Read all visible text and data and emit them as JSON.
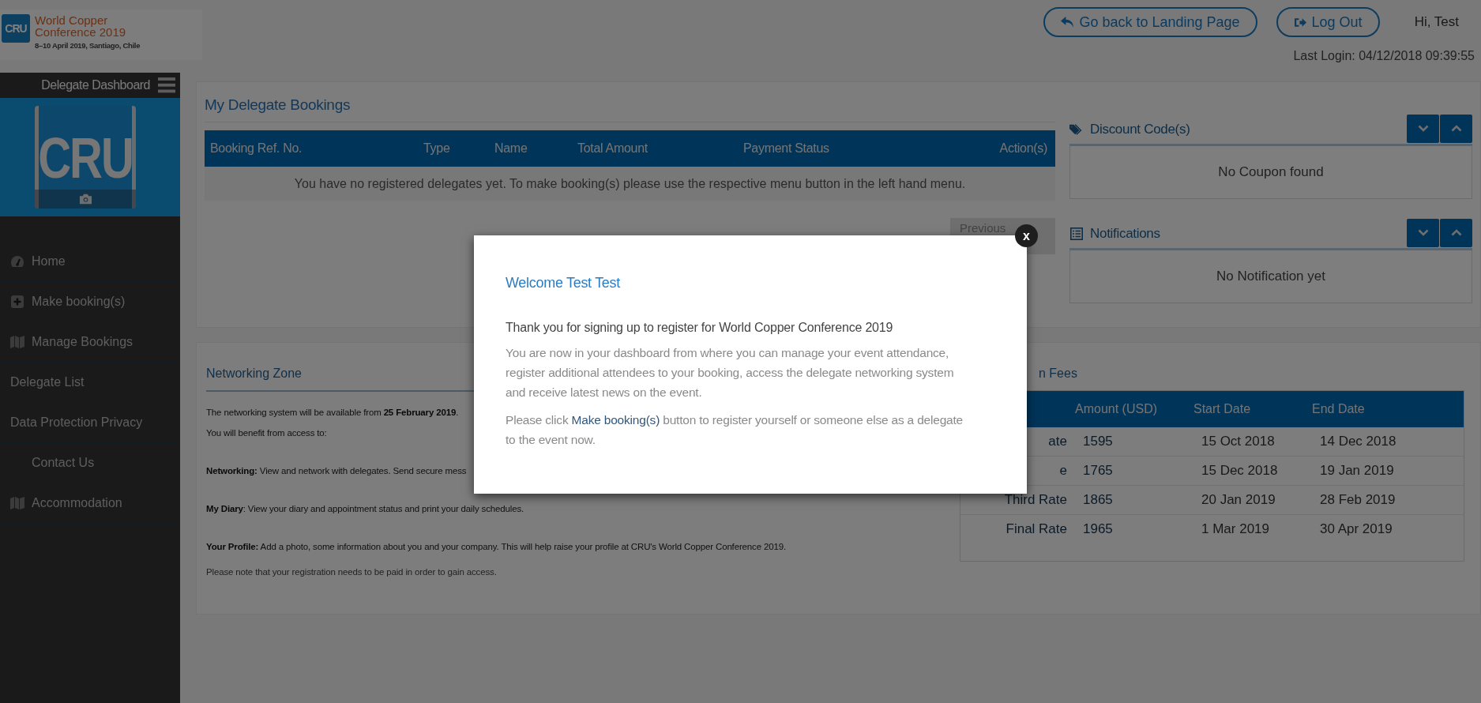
{
  "header": {
    "logo": {
      "mark": "CRU",
      "line1": "World Copper",
      "line2": "Conference 2019",
      "dates": "8–10 April 2019, Santiago, Chile"
    },
    "buttons": [
      {
        "label": "Go back to Landing Page",
        "kind": "back"
      },
      {
        "label": "Log Out",
        "kind": "logout"
      }
    ],
    "greeting": "Hi, Test",
    "last_login": "Last Login: 04/12/2018 09:39:55"
  },
  "sidebar": {
    "title": "Delegate Dashboard",
    "avatar_mark": "CRU",
    "items": [
      {
        "label": "Home",
        "kind": "dashboard"
      },
      {
        "label": "Make booking(s)",
        "kind": "plus"
      },
      {
        "label": "Manage Bookings",
        "kind": "map"
      },
      {
        "label": "Delegate List",
        "kind": "plain"
      },
      {
        "label": "Data Protection Privacy",
        "kind": "plain"
      },
      {
        "label": "Contact Us",
        "kind": "indented"
      },
      {
        "label": "Accommodation",
        "kind": "map"
      }
    ]
  },
  "bookings": {
    "title": "My Delegate Bookings",
    "columns": [
      "Booking Ref. No.",
      "Type",
      "Name",
      "Total Amount",
      "Payment Status",
      "Action(s)"
    ],
    "empty_message": "You have no registered delegates yet. To make booking(s) please use the respective menu button in the left hand menu.",
    "pager": [
      "Previous"
    ]
  },
  "panels": [
    {
      "title": "Discount Code(s)",
      "kind": "tags",
      "message": "No Coupon found"
    },
    {
      "title": "Notifications",
      "kind": "list",
      "message": "No Notification yet"
    }
  ],
  "networking": {
    "title": "Networking Zone",
    "paragraphs": [
      "The networking system will be available from **25 February 2019**.",
      "You will benefit from access to:",
      "**Networking:** View and network with delegates. Send secure mess",
      "**My Diary**: View your diary and appointment status and print your daily schedules.",
      "**Your Profile:** Add a photo, some information about you and your company. This will help raise your profile at CRU's World Copper Conference 2019.",
      "Please note that your registration needs to be paid in order to gain access."
    ]
  },
  "fees": {
    "title": "n Fees",
    "columns": [
      "",
      "Amount (USD)",
      "Start Date",
      "End Date"
    ],
    "rows": [
      [
        "ate",
        "1595",
        "15 Oct 2018",
        "14 Dec 2018"
      ],
      [
        "e",
        "1765",
        "15 Dec 2018",
        "19 Jan 2019"
      ],
      [
        "Third Rate",
        "1865",
        "20 Jan 2019",
        "28 Feb 2019"
      ],
      [
        "Final Rate",
        "1965",
        "1 Mar 2019",
        "30 Apr 2019"
      ]
    ]
  },
  "modal": {
    "title": "Welcome Test Test",
    "lead": "Thank you for signing up to register for World Copper Conference 2019",
    "paragraphs": [
      "You are now in your dashboard from where you can manage your event attendance, register additional attendees to your booking, access the delegate networking system and receive latest news on the event.",
      "Please click **Make booking(s)** button to register yourself or someone else as a delegate to the event now."
    ],
    "close": "x"
  }
}
